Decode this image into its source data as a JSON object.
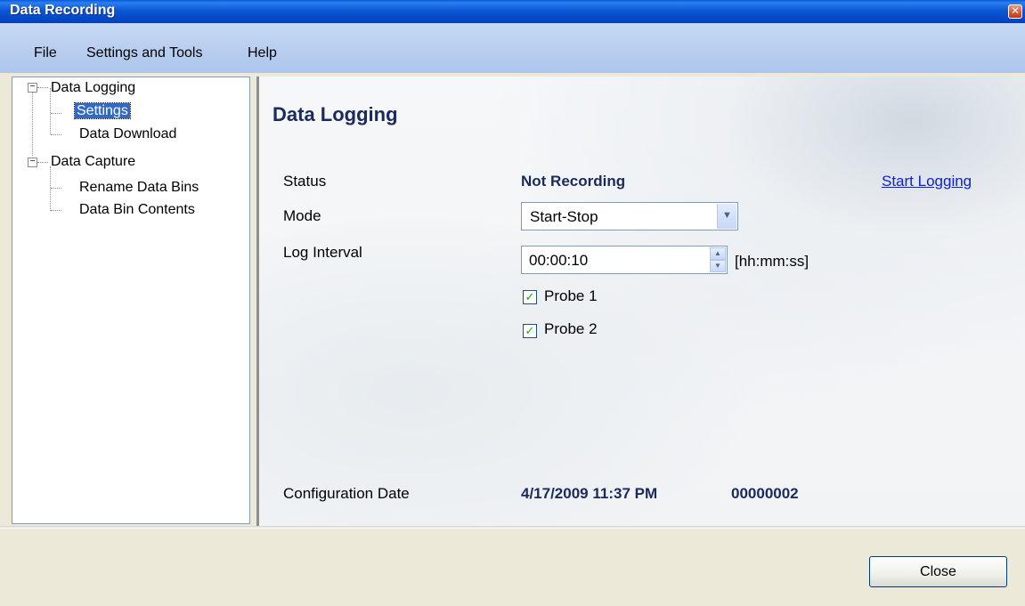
{
  "window": {
    "title": "Data Recording"
  },
  "menu": {
    "file": "File",
    "settings_tools": "Settings and Tools",
    "help": "Help"
  },
  "tree": {
    "data_logging": "Data Logging",
    "settings": "Settings",
    "data_download": "Data Download",
    "data_capture": "Data Capture",
    "rename_data_bins": "Rename Data Bins",
    "data_bin_contents": "Data Bin Contents"
  },
  "content": {
    "heading": "Data Logging",
    "status_label": "Status",
    "status_value": "Not Recording",
    "start_logging": "Start Logging",
    "mode_label": "Mode",
    "mode_value": "Start-Stop",
    "interval_label": "Log Interval",
    "interval_value": "00:00:10",
    "interval_unit": "[hh:mm:ss]",
    "probe1": "Probe 1",
    "probe2": "Probe 2",
    "config_label": "Configuration Date",
    "config_date": "4/17/2009 11:37 PM",
    "config_id": "00000002"
  },
  "footer": {
    "close": "Close"
  }
}
